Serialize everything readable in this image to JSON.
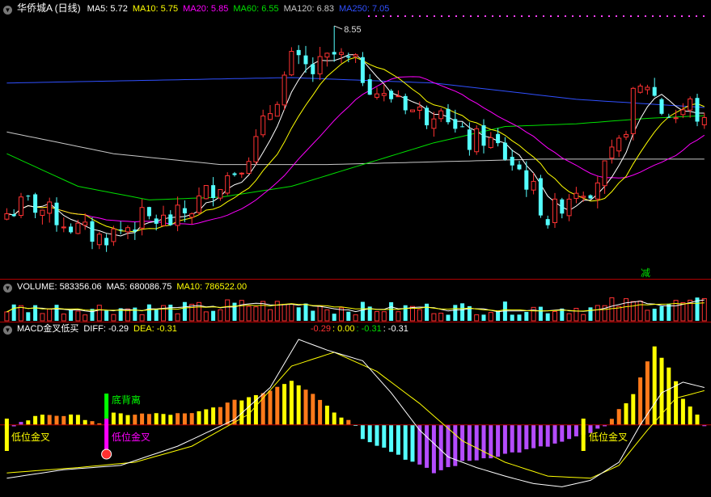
{
  "colors": {
    "up": "#ff3232",
    "down": "#54ffff",
    "ma5": "#ffffff",
    "ma10": "#ffff00",
    "ma20": "#ff00ff",
    "ma60": "#00e000",
    "ma120": "#c8c8c8",
    "ma250": "#3050ff",
    "diff": "#ffffff",
    "dea": "#ffff00",
    "macd_pos_a": "#ff7a1a",
    "macd_pos_b": "#ffff00",
    "macd_neg_a": "#54ffff",
    "macd_neg_b": "#b44cff",
    "separator": "#b00000",
    "grid_dot": "#ff40ff"
  },
  "main_panel": {
    "title": "华侨城A (日线)",
    "ma5": "MA5: 5.72",
    "ma10": "MA10: 5.75",
    "ma20": "MA20: 5.85",
    "ma60": "MA60: 6.55",
    "ma120": "MA120: 6.83",
    "ma250": "MA250: 7.05",
    "high_label": "8.55",
    "reduce_label": "减"
  },
  "volume_panel": {
    "title": "VOLUME: 583356.06",
    "ma5": "MA5: 680086.75",
    "ma10": "MA10: 786522.00"
  },
  "macd_panel": {
    "title": "MACD金叉低买",
    "diff": "DIFF: -0.29",
    "dea": "DEA: -0.31",
    "extra_1": "-0.29",
    "extra_2": ": 0.00",
    "extra_3": ": -0.31",
    "extra_4": ": -0.31",
    "labels": {
      "low_cross_1": "低位金叉",
      "bottom_divergence": "底背离",
      "low_cross_2": "低位金叉",
      "low_cross_3": "低位金叉"
    }
  },
  "chart_data": {
    "type": "candlestick",
    "bars": 99,
    "price_range": [
      4.3,
      8.7
    ],
    "high_marker": {
      "bar": 46,
      "value": 8.55
    },
    "close_path": [
      [
        0,
        5.1
      ],
      [
        3,
        5.3
      ],
      [
        6,
        5.1
      ],
      [
        10,
        4.8
      ],
      [
        13,
        4.65
      ],
      [
        16,
        4.8
      ],
      [
        19,
        5.0
      ],
      [
        23,
        4.95
      ],
      [
        26,
        5.2
      ],
      [
        29,
        5.6
      ],
      [
        32,
        5.9
      ],
      [
        35,
        6.4
      ],
      [
        37,
        7.0
      ],
      [
        40,
        7.9
      ],
      [
        43,
        7.7
      ],
      [
        46,
        8.0
      ],
      [
        49,
        7.8
      ],
      [
        51,
        7.5
      ],
      [
        53,
        7.2
      ],
      [
        55,
        7.3
      ],
      [
        57,
        7.0
      ],
      [
        59,
        6.9
      ],
      [
        61,
        7.2
      ],
      [
        63,
        6.6
      ],
      [
        65,
        6.4
      ],
      [
        67,
        6.5
      ],
      [
        69,
        6.3
      ],
      [
        72,
        5.9
      ],
      [
        74,
        5.5
      ],
      [
        76,
        5.0
      ],
      [
        78,
        5.3
      ],
      [
        80,
        5.6
      ],
      [
        82,
        5.6
      ],
      [
        84,
        5.9
      ],
      [
        86,
        6.3
      ],
      [
        88,
        7.2
      ],
      [
        90,
        7.5
      ],
      [
        92,
        7.0
      ],
      [
        94,
        6.9
      ],
      [
        96,
        7.1
      ],
      [
        98,
        6.7
      ]
    ],
    "volume_range": [
      0,
      1800000
    ],
    "macd_range": [
      -0.6,
      0.8
    ],
    "macd_path": [
      [
        0,
        -0.03
      ],
      [
        5,
        0.1
      ],
      [
        10,
        0.08
      ],
      [
        14,
        0.0
      ],
      [
        15,
        0.1
      ],
      [
        20,
        0.1
      ],
      [
        26,
        0.1
      ],
      [
        30,
        0.18
      ],
      [
        36,
        0.3
      ],
      [
        40,
        0.42
      ],
      [
        43,
        0.3
      ],
      [
        46,
        0.12
      ],
      [
        49,
        0.0
      ],
      [
        50,
        -0.12
      ],
      [
        55,
        -0.28
      ],
      [
        60,
        -0.45
      ],
      [
        64,
        -0.35
      ],
      [
        68,
        -0.3
      ],
      [
        72,
        -0.25
      ],
      [
        76,
        -0.2
      ],
      [
        81,
        -0.1
      ],
      [
        84,
        -0.02
      ],
      [
        85,
        0.05
      ],
      [
        88,
        0.3
      ],
      [
        91,
        0.72
      ],
      [
        93,
        0.55
      ],
      [
        95,
        0.25
      ],
      [
        98,
        0.0
      ]
    ],
    "diff_path": [
      [
        0,
        -0.5
      ],
      [
        8,
        -0.42
      ],
      [
        16,
        -0.38
      ],
      [
        24,
        -0.2
      ],
      [
        32,
        0.05
      ],
      [
        37,
        0.35
      ],
      [
        41,
        0.8
      ],
      [
        45,
        0.7
      ],
      [
        50,
        0.6
      ],
      [
        54,
        0.3
      ],
      [
        58,
        -0.05
      ],
      [
        62,
        -0.3
      ],
      [
        66,
        -0.4
      ],
      [
        70,
        -0.48
      ],
      [
        74,
        -0.55
      ],
      [
        78,
        -0.58
      ],
      [
        82,
        -0.52
      ],
      [
        86,
        -0.35
      ],
      [
        89,
        0.0
      ],
      [
        92,
        0.3
      ],
      [
        95,
        0.4
      ],
      [
        98,
        0.35
      ]
    ],
    "dea_path": [
      [
        0,
        -0.45
      ],
      [
        10,
        -0.4
      ],
      [
        18,
        -0.35
      ],
      [
        26,
        -0.2
      ],
      [
        34,
        0.1
      ],
      [
        40,
        0.55
      ],
      [
        46,
        0.68
      ],
      [
        52,
        0.5
      ],
      [
        58,
        0.2
      ],
      [
        64,
        -0.15
      ],
      [
        70,
        -0.35
      ],
      [
        76,
        -0.48
      ],
      [
        82,
        -0.5
      ],
      [
        86,
        -0.38
      ],
      [
        90,
        -0.05
      ],
      [
        94,
        0.25
      ],
      [
        98,
        0.32
      ]
    ],
    "ma_paths": {
      "ma250": [
        [
          0,
          7.5
        ],
        [
          20,
          7.55
        ],
        [
          40,
          7.6
        ],
        [
          60,
          7.5
        ],
        [
          80,
          7.2
        ],
        [
          98,
          7.05
        ]
      ],
      "ma120": [
        [
          0,
          6.6
        ],
        [
          15,
          6.2
        ],
        [
          30,
          6.0
        ],
        [
          45,
          6.0
        ],
        [
          60,
          6.05
        ],
        [
          75,
          6.1
        ],
        [
          98,
          6.1
        ]
      ],
      "ma60": [
        [
          0,
          6.2
        ],
        [
          10,
          5.6
        ],
        [
          20,
          5.35
        ],
        [
          30,
          5.4
        ],
        [
          40,
          5.6
        ],
        [
          50,
          6.0
        ],
        [
          60,
          6.4
        ],
        [
          70,
          6.7
        ],
        [
          80,
          6.75
        ],
        [
          90,
          6.85
        ],
        [
          98,
          6.9
        ]
      ]
    }
  }
}
